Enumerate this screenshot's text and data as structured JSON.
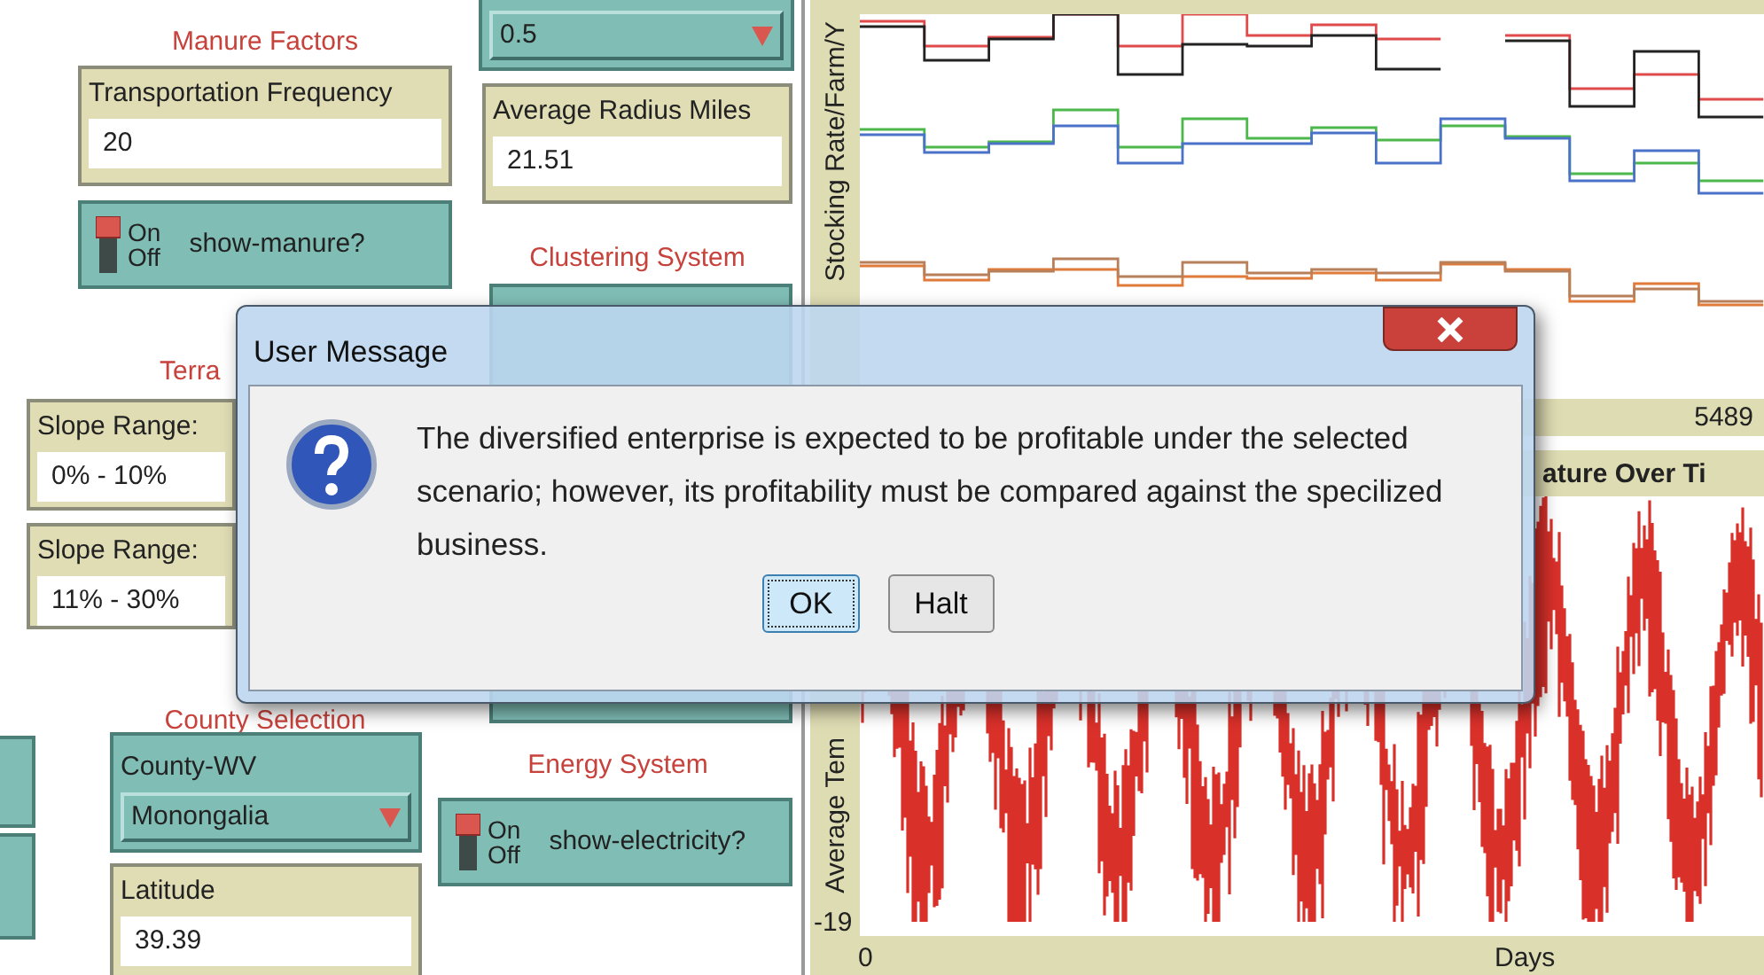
{
  "widgets": [
    {
      "kind": "label",
      "text": "Manure Factors"
    },
    {
      "kind": "monitor",
      "label": "Transportation Frequency",
      "value": "20"
    },
    {
      "kind": "switch",
      "on_label": "On",
      "off_label": "Off",
      "name": "show-manure?",
      "on": true
    },
    {
      "kind": "chooser",
      "value": "0.5"
    },
    {
      "kind": "monitor",
      "label": "Average Radius Miles",
      "value": "21.51"
    },
    {
      "kind": "label",
      "text": "Clustering System"
    },
    {
      "kind": "label",
      "text": "Terra"
    },
    {
      "kind": "monitor",
      "label": "Slope Range:",
      "value": "0% - 10%"
    },
    {
      "kind": "monitor",
      "label": "Slope Range:",
      "value": "11% - 30%"
    },
    {
      "kind": "label",
      "text": "County Selection"
    },
    {
      "kind": "chooser",
      "label": "County-WV",
      "value": "Monongalia"
    },
    {
      "kind": "monitor",
      "label": "Latitude",
      "value": "39.39"
    },
    {
      "kind": "label",
      "text": "Energy System"
    },
    {
      "kind": "switch",
      "on_label": "On",
      "off_label": "Off",
      "name": "show-electricity?",
      "on": true
    }
  ],
  "plots": [
    {
      "ylabel": "Stocking Rate/Farm/Y",
      "xmax": "5489"
    },
    {
      "title": "ature Over Ti",
      "ylabel": "Average Tem",
      "ymin": "-19",
      "xmin": "0",
      "xlabel": "Days"
    }
  ],
  "dialog": {
    "title": "User Message",
    "message": "The diversified enterprise is expected to be profitable under the selected scenario; however, its profitability must be compared against the specilized business.",
    "buttons": [
      {
        "label": "OK",
        "focused": true
      },
      {
        "label": "Halt",
        "focused": false
      }
    ]
  }
}
